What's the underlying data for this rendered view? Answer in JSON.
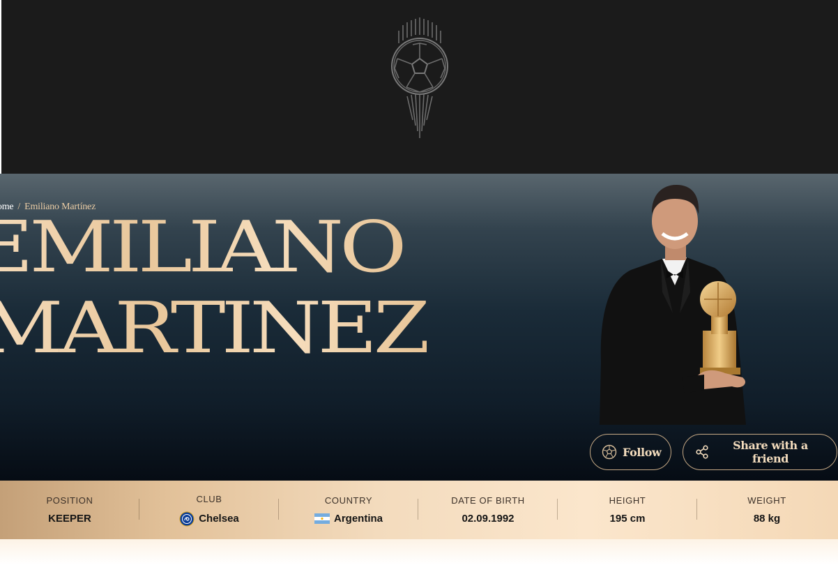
{
  "header": {
    "logo_icon": "ballon-dor-ball-icon"
  },
  "breadcrumb": {
    "home": "Home",
    "separator": "/",
    "current": "Emiliano Martínez"
  },
  "player": {
    "first_name": "EMILIANO",
    "last_name": "MARTINEZ",
    "photo_icon": "player-photo"
  },
  "actions": {
    "follow_label": "Follow",
    "follow_icon": "ball-icon",
    "share_label": "Share with a friend",
    "share_icon": "share-icon"
  },
  "stats": [
    {
      "label": "POSITION",
      "value": "KEEPER"
    },
    {
      "label": "CLUB",
      "value": "Chelsea",
      "icon": "chelsea-crest-icon"
    },
    {
      "label": "COUNTRY",
      "value": "Argentina",
      "icon": "argentina-flag-icon"
    },
    {
      "label": "DATE OF BIRTH",
      "value": "02.09.1992"
    },
    {
      "label": "HEIGHT",
      "value": "195 cm"
    },
    {
      "label": "WEIGHT",
      "value": "88 kg"
    }
  ],
  "colors": {
    "topbar": "#1b1b1b",
    "gold_text": "#e9c79b",
    "hero_dark": "#0b1621"
  }
}
